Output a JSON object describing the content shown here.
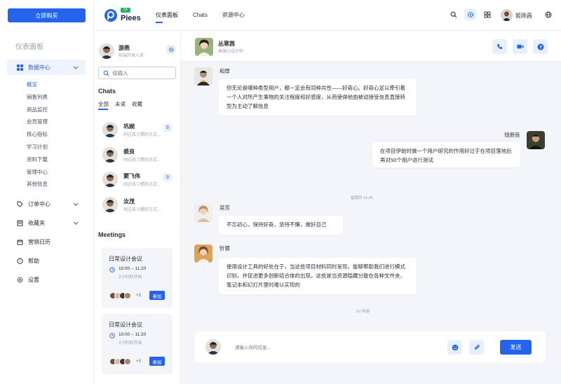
{
  "sidebar": {
    "buy_label": "立即购买",
    "title": "仪表面板",
    "data_center": "数据中心",
    "sub_items": [
      "概览",
      "销售列表",
      "商品监控",
      "会员管理",
      "核心指标",
      "学习计划",
      "资料下载",
      "管理中心",
      "其他信息"
    ],
    "orders": "订单中心",
    "favorites": "收藏夹",
    "calendar": "营销日历",
    "help": "帮助",
    "settings": "设置"
  },
  "topbar": {
    "logo_badge": "10",
    "logo_text": "Piees",
    "nav": [
      "仪表面板",
      "Chats",
      "资源中心"
    ],
    "user_name": "姬刚昌"
  },
  "chatlist": {
    "me_name": "游燕",
    "me_role": "前端开发人员",
    "search_placeholder": "请输入",
    "chats_title": "Chats",
    "tabs": [
      "全部",
      "未读",
      "收藏"
    ],
    "conversations": [
      {
        "name": "巩婉",
        "preview": "同过去习惯的方式...",
        "badge": "6"
      },
      {
        "name": "裘良",
        "preview": "同过去习惯的方式...",
        "badge": ""
      },
      {
        "name": "窦飞伟",
        "preview": "同过去习惯的方式...",
        "badge": "9"
      },
      {
        "name": "汝茂",
        "preview": "同过去习惯的方式...",
        "badge": ""
      }
    ],
    "meetings_title": "Meetings",
    "meetings": [
      {
        "title": "日常设计会议",
        "time": "10:00 – 11:20",
        "status": "2小时后开始",
        "plus": "+3",
        "join": "参加"
      },
      {
        "title": "日常设计会议",
        "time": "10:00 – 11:20",
        "status": "2小时后开始",
        "plus": "+3",
        "join": "参加"
      }
    ]
  },
  "chat": {
    "contact_name": "丛寒茜",
    "contact_role": "高级UI设计师",
    "messages": [
      {
        "name": "和厚",
        "text": "但无论是哪种类型用户，都一定会有同种共性——好奇心。好奇心足以牵引着一个人对所产生事物的关注程度和好感度，从而使得他由被动接受信息直接转型为主动了解信息"
      },
      {
        "name": "钱朋良",
        "text": "在项目伊始时做一个用户研究的作用好过于在项目落地后再对50个用户进行测试"
      },
      {
        "name": "吴芳",
        "text": "不忘初心，保持好奇，坚持不懈，做好自己"
      },
      {
        "name": "忻蓉",
        "text": "使用设计工具的好处在于，当这些项目材料同时呈现，能够帮助我们进行模式识别，并促进更多创新结合体的出现。这些是当资源隐藏分散在各种文件夹、笔记本和幻灯片里时难以实现的"
      }
    ],
    "time_stamp_1": "星期四 16:45",
    "time_stamp_2": "2小时前",
    "input_placeholder": "请输入你的信息...",
    "send_label": "发送"
  },
  "colors": {
    "accent": "#2563eb",
    "badge_green": "#27ae60"
  }
}
